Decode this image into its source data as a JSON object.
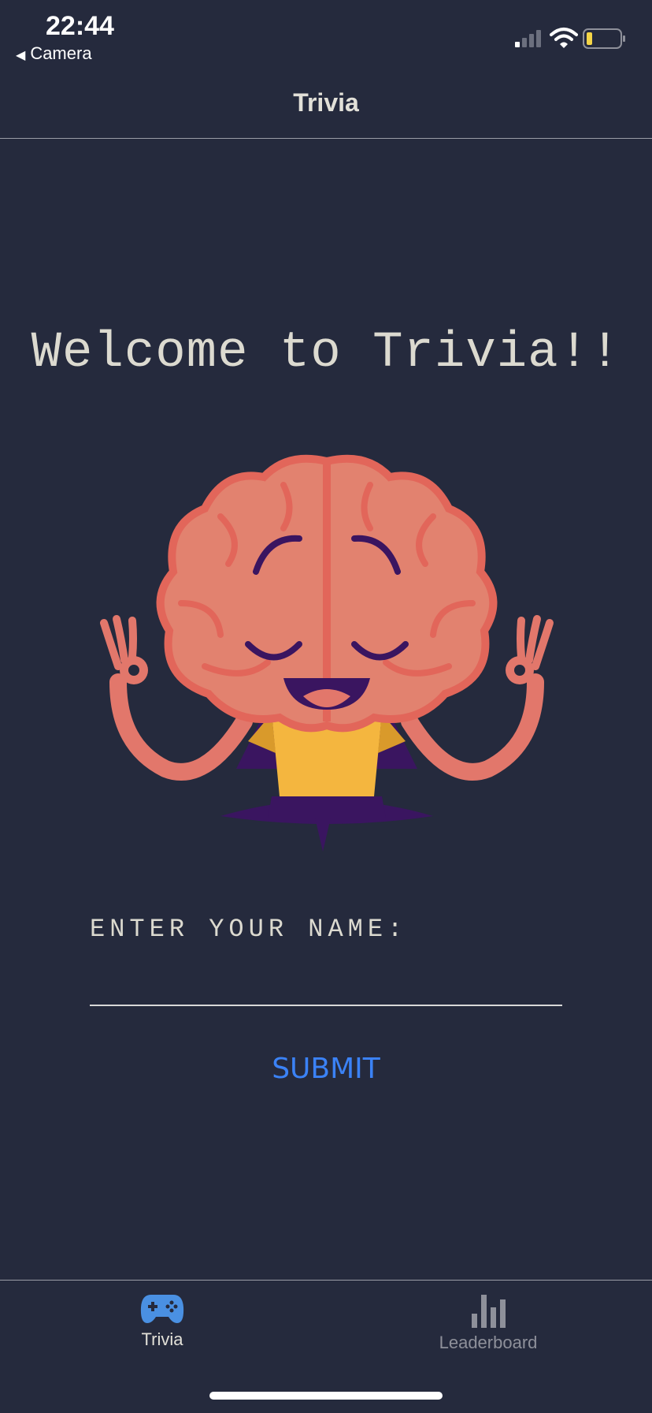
{
  "status_bar": {
    "time": "22:44",
    "back_app_label": "Camera",
    "back_arrow": "◀",
    "icons": [
      "signal-icon",
      "wifi-icon",
      "battery-low-icon"
    ]
  },
  "nav": {
    "title": "Trivia"
  },
  "main": {
    "welcome_text": "Welcome to Trivia!!",
    "mascot": "meditating-brain-illustration",
    "name_label": "ENTER YOUR NAME:",
    "name_value": "",
    "submit_label": "SUBMIT"
  },
  "tabs": [
    {
      "label": "Trivia",
      "icon": "gamepad-icon",
      "active": true
    },
    {
      "label": "Leaderboard",
      "icon": "bar-chart-icon",
      "active": false
    }
  ],
  "colors": {
    "background": "#252a3d",
    "accent": "#3b82f6",
    "text": "#e2e0d8",
    "inactive_tab": "#8e909a"
  }
}
